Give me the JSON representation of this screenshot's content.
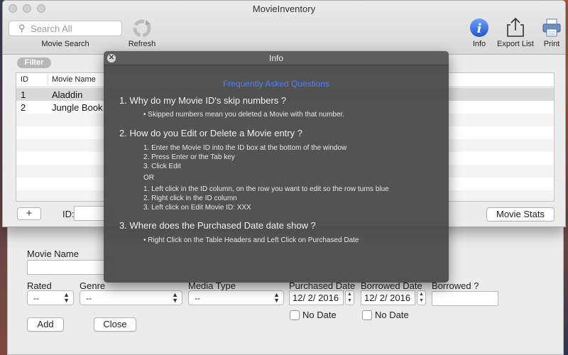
{
  "window": {
    "title": "MovieInventory"
  },
  "toolbar": {
    "search_placeholder": "Search All",
    "movie_search_label": "Movie Search",
    "refresh_label": "Refresh",
    "info_label": "Info",
    "export_label": "Export List",
    "print_label": "Print",
    "icons": [
      "search-icon",
      "refresh-icon",
      "info-icon",
      "share-icon",
      "printer-icon"
    ],
    "accent_color": "#2f6fd8"
  },
  "list": {
    "filter_label": "Filter",
    "columns": [
      "ID",
      "Movie Name"
    ],
    "rows": [
      {
        "id": "1",
        "name": "Aladdin"
      },
      {
        "id": "2",
        "name": "Jungle Book"
      }
    ],
    "add_label": "+",
    "id_label": "ID:",
    "stats_button": "Movie Stats"
  },
  "info": {
    "title": "Info",
    "close_glyph": "✕",
    "heading": "Frequently Asked Questions",
    "heading_color": "#4f7ef2",
    "q1": "1. Why do my Movie ID's skip numbers ?",
    "q1_answer": "• Skipped numbers mean you deleted a Movie with that number.",
    "q2": "2. How do you Edit or Delete a Movie entry ?",
    "q2_steps_a": [
      "1. Enter the Movie ID into the ID box at the bottom of the window",
      "2. Press Enter or the Tab key",
      "3. Click Edit"
    ],
    "q2_or": "OR",
    "q2_steps_b": [
      "1. Left click in the ID column, on the row you want to edit so the row turns blue",
      "2. Right click in the ID column",
      "3. Left click on Edit Movie ID: XXX"
    ],
    "q3": "3. Where does the Purchased Date date show ?",
    "q3_answer": "• Right Click on the Table Headers and Left Click on Purchased Date"
  },
  "form": {
    "movie_name_label": "Movie Name",
    "rated_label": "Rated",
    "rated_value": "--",
    "genre_label": "Genre",
    "genre_value": "--",
    "media_type_label": "Media Type",
    "media_type_value": "--",
    "purchased_label": "Purchased Date",
    "purchased_value": "12/  2/ 2016",
    "borrowed_label": "Borrowed Date",
    "borrowed_value": "12/  2/ 2016",
    "borrowed_q_label": "Borrowed ?",
    "no_date_label": "No Date",
    "add_button": "Add",
    "close_button": "Close"
  }
}
